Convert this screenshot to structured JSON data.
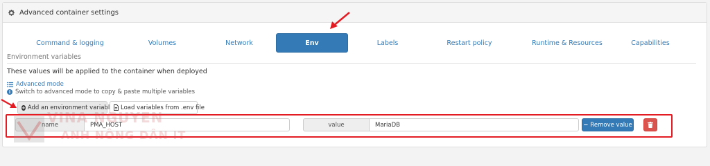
{
  "panel": {
    "title": "Advanced container settings",
    "icon": "gear-icon"
  },
  "tabs": [
    {
      "label": "Command & logging",
      "active": false
    },
    {
      "label": "Volumes",
      "active": false
    },
    {
      "label": "Network",
      "active": false
    },
    {
      "label": "Env",
      "active": true
    },
    {
      "label": "Labels",
      "active": false
    },
    {
      "label": "Restart policy",
      "active": false
    },
    {
      "label": "Runtime & Resources",
      "active": false
    },
    {
      "label": "Capabilities",
      "active": false
    }
  ],
  "env": {
    "section_title": "Environment variables",
    "info_text": "These values will be applied to the container when deployed",
    "advanced_mode_link": "Advanced mode",
    "hint": "Switch to advanced mode to copy & paste multiple variables",
    "add_button": "Add an environment variable",
    "load_button": "Load variables from .env file",
    "variables": [
      {
        "name_label": "name",
        "name": "PMA_HOST",
        "value_label": "value",
        "value": "MariaDB",
        "remove_label": "Remove value"
      }
    ]
  },
  "watermark": {
    "line1": "VINA NGUYEN",
    "line2": "ANH NÔNG DÂN IT"
  },
  "colors": {
    "accent": "#337ab7",
    "danger": "#d9534f",
    "annotation_red": "#e31b23"
  }
}
